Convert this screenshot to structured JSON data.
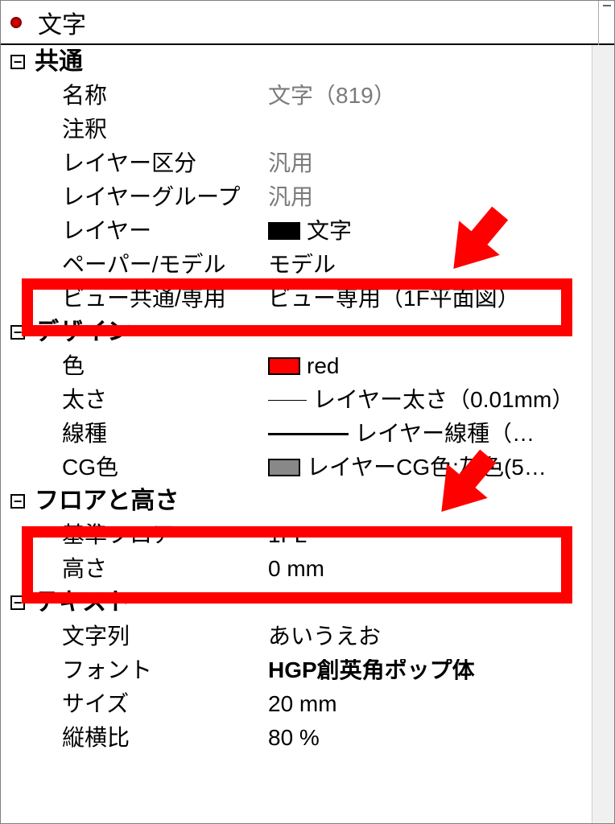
{
  "header": {
    "title": "文字"
  },
  "sections": {
    "common": {
      "title": "共通",
      "rows": {
        "name_label": "名称",
        "name_value": "文字（819）",
        "note_label": "注釈",
        "layer_class_label": "レイヤー区分",
        "layer_class_value": "汎用",
        "layer_group_label": "レイヤーグループ",
        "layer_group_value": "汎用",
        "layer_label": "レイヤー",
        "layer_value": "文字",
        "paper_model_label": "ペーパー/モデル",
        "paper_model_value": "モデル",
        "view_label": "ビュー共通/専用",
        "view_value": "ビュー専用（1F平面図）"
      }
    },
    "design": {
      "title": "デザイン",
      "rows": {
        "color_label": "色",
        "color_value": "red",
        "weight_label": "太さ",
        "weight_value": "レイヤー太さ（0.01mm）",
        "linetype_label": "線種",
        "linetype_value": "レイヤー線種（…",
        "cgcolor_label": "CG色",
        "cgcolor_value": "レイヤーCG色:灰色(5…"
      }
    },
    "floor": {
      "title": "フロアと高さ",
      "rows": {
        "base_label": "基準フロア",
        "base_value": "1FL",
        "height_label": "高さ",
        "height_value": "0 mm"
      }
    },
    "text": {
      "title": "テキスト",
      "rows": {
        "string_label": "文字列",
        "string_value": "あいうえお",
        "font_label": "フォント",
        "font_value": "HGP創英角ポップ体",
        "size_label": "サイズ",
        "size_value": "20 mm",
        "ratio_label": "縦横比",
        "ratio_value": "80 %"
      }
    }
  },
  "annotations": {
    "highlight_color": "#ff0000"
  }
}
